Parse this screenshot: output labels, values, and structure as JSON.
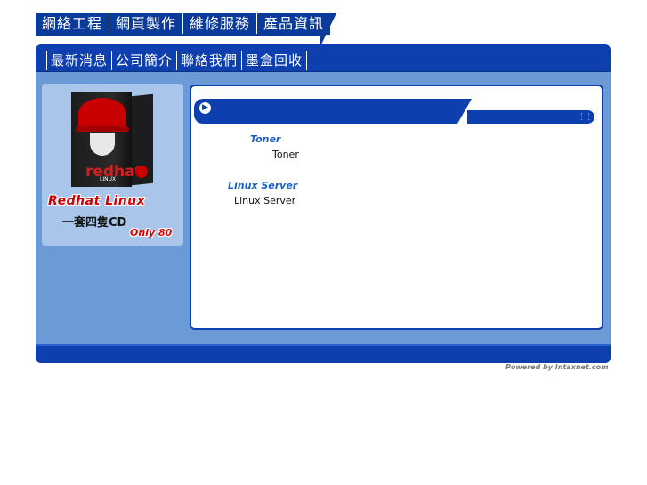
{
  "top_tabs": [
    "網絡工程",
    "網頁製作",
    "維修服務",
    "產品資訊"
  ],
  "sub_nav": [
    "最新消息",
    "公司簡介",
    "聯絡我們",
    "墨盒回收"
  ],
  "ad": {
    "box_brand": "redhat",
    "box_sub": "LINUX",
    "title": "Redhat Linux",
    "description": "一套四隻CD",
    "price": "Only 80"
  },
  "products": [
    {
      "title": "Toner",
      "item": "Toner"
    },
    {
      "title": "Linux Server",
      "item": "Linux Server"
    }
  ],
  "footer": {
    "powered_by": "Powered by Intaxnet.com"
  },
  "colors": {
    "primary_blue": "#0d3fae",
    "panel_blue": "#6b9ad6",
    "light_blue": "#a9c6ea",
    "link_blue": "#1b5fc2",
    "accent_red": "#d30000"
  },
  "icons": {
    "content_header": "arrow-right-circle-icon",
    "content_header_right": "grid-dots-icon"
  }
}
